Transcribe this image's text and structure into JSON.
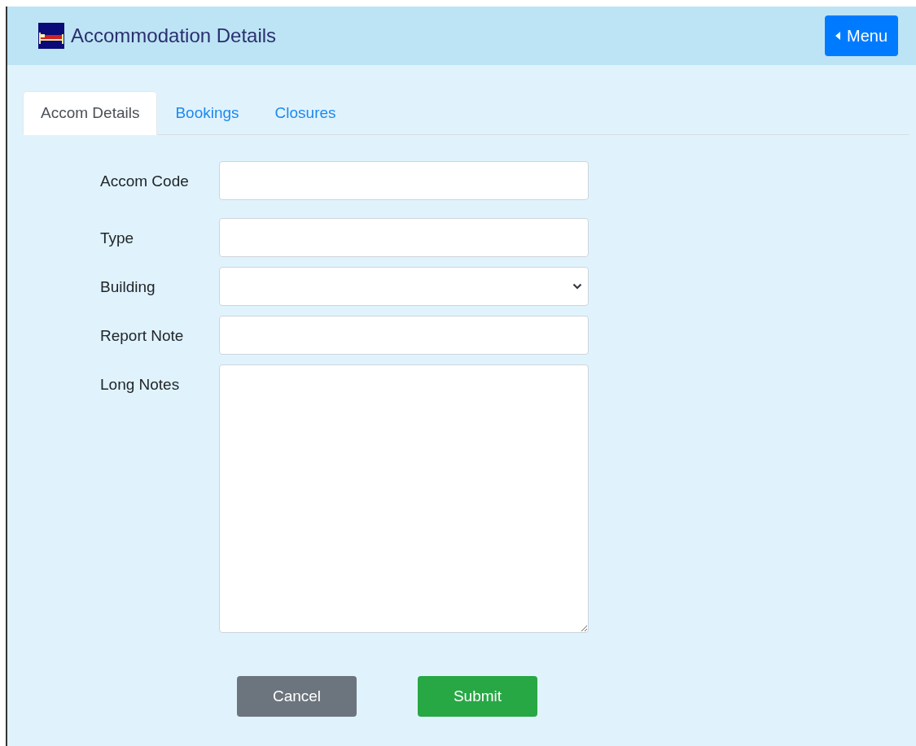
{
  "header": {
    "title": "Accommodation Details",
    "menu_button": "Menu"
  },
  "tabs": [
    {
      "label": "Accom Details",
      "selected": true
    },
    {
      "label": "Bookings",
      "selected": false
    },
    {
      "label": "Closures",
      "selected": false
    }
  ],
  "form": {
    "fields": [
      {
        "label": "Accom Code",
        "kind": "input"
      },
      {
        "label": "Type",
        "kind": "input"
      },
      {
        "label": "Building",
        "kind": "select"
      },
      {
        "label": "Report Note",
        "kind": "input"
      },
      {
        "label": "Long Notes",
        "kind": "textarea"
      }
    ],
    "buttons": [
      {
        "label": "Cancel",
        "kind": "secondary"
      },
      {
        "label": "Submit",
        "kind": "primary"
      }
    ]
  }
}
